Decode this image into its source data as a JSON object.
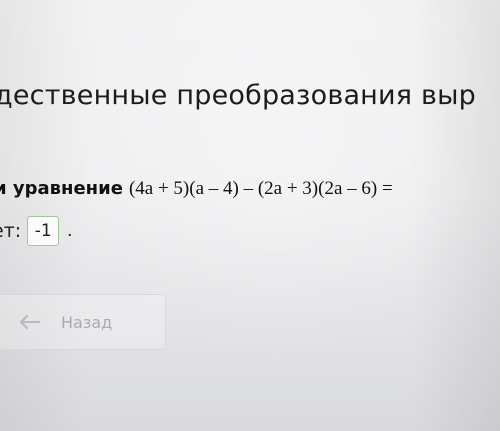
{
  "page": {
    "title": "дественные преобразования выр"
  },
  "question": {
    "lead": "и уравнение",
    "expression": "(4a + 5)(a – 4) – (2a + 3)(2a – 6) ="
  },
  "answer": {
    "label": "ет:",
    "value": "-1",
    "suffix": "."
  },
  "navigation": {
    "back_label": "Назад",
    "back_icon": "arrow-left-icon"
  },
  "colors": {
    "input_border": "#9ec79a",
    "muted_text": "#a9abaf"
  }
}
